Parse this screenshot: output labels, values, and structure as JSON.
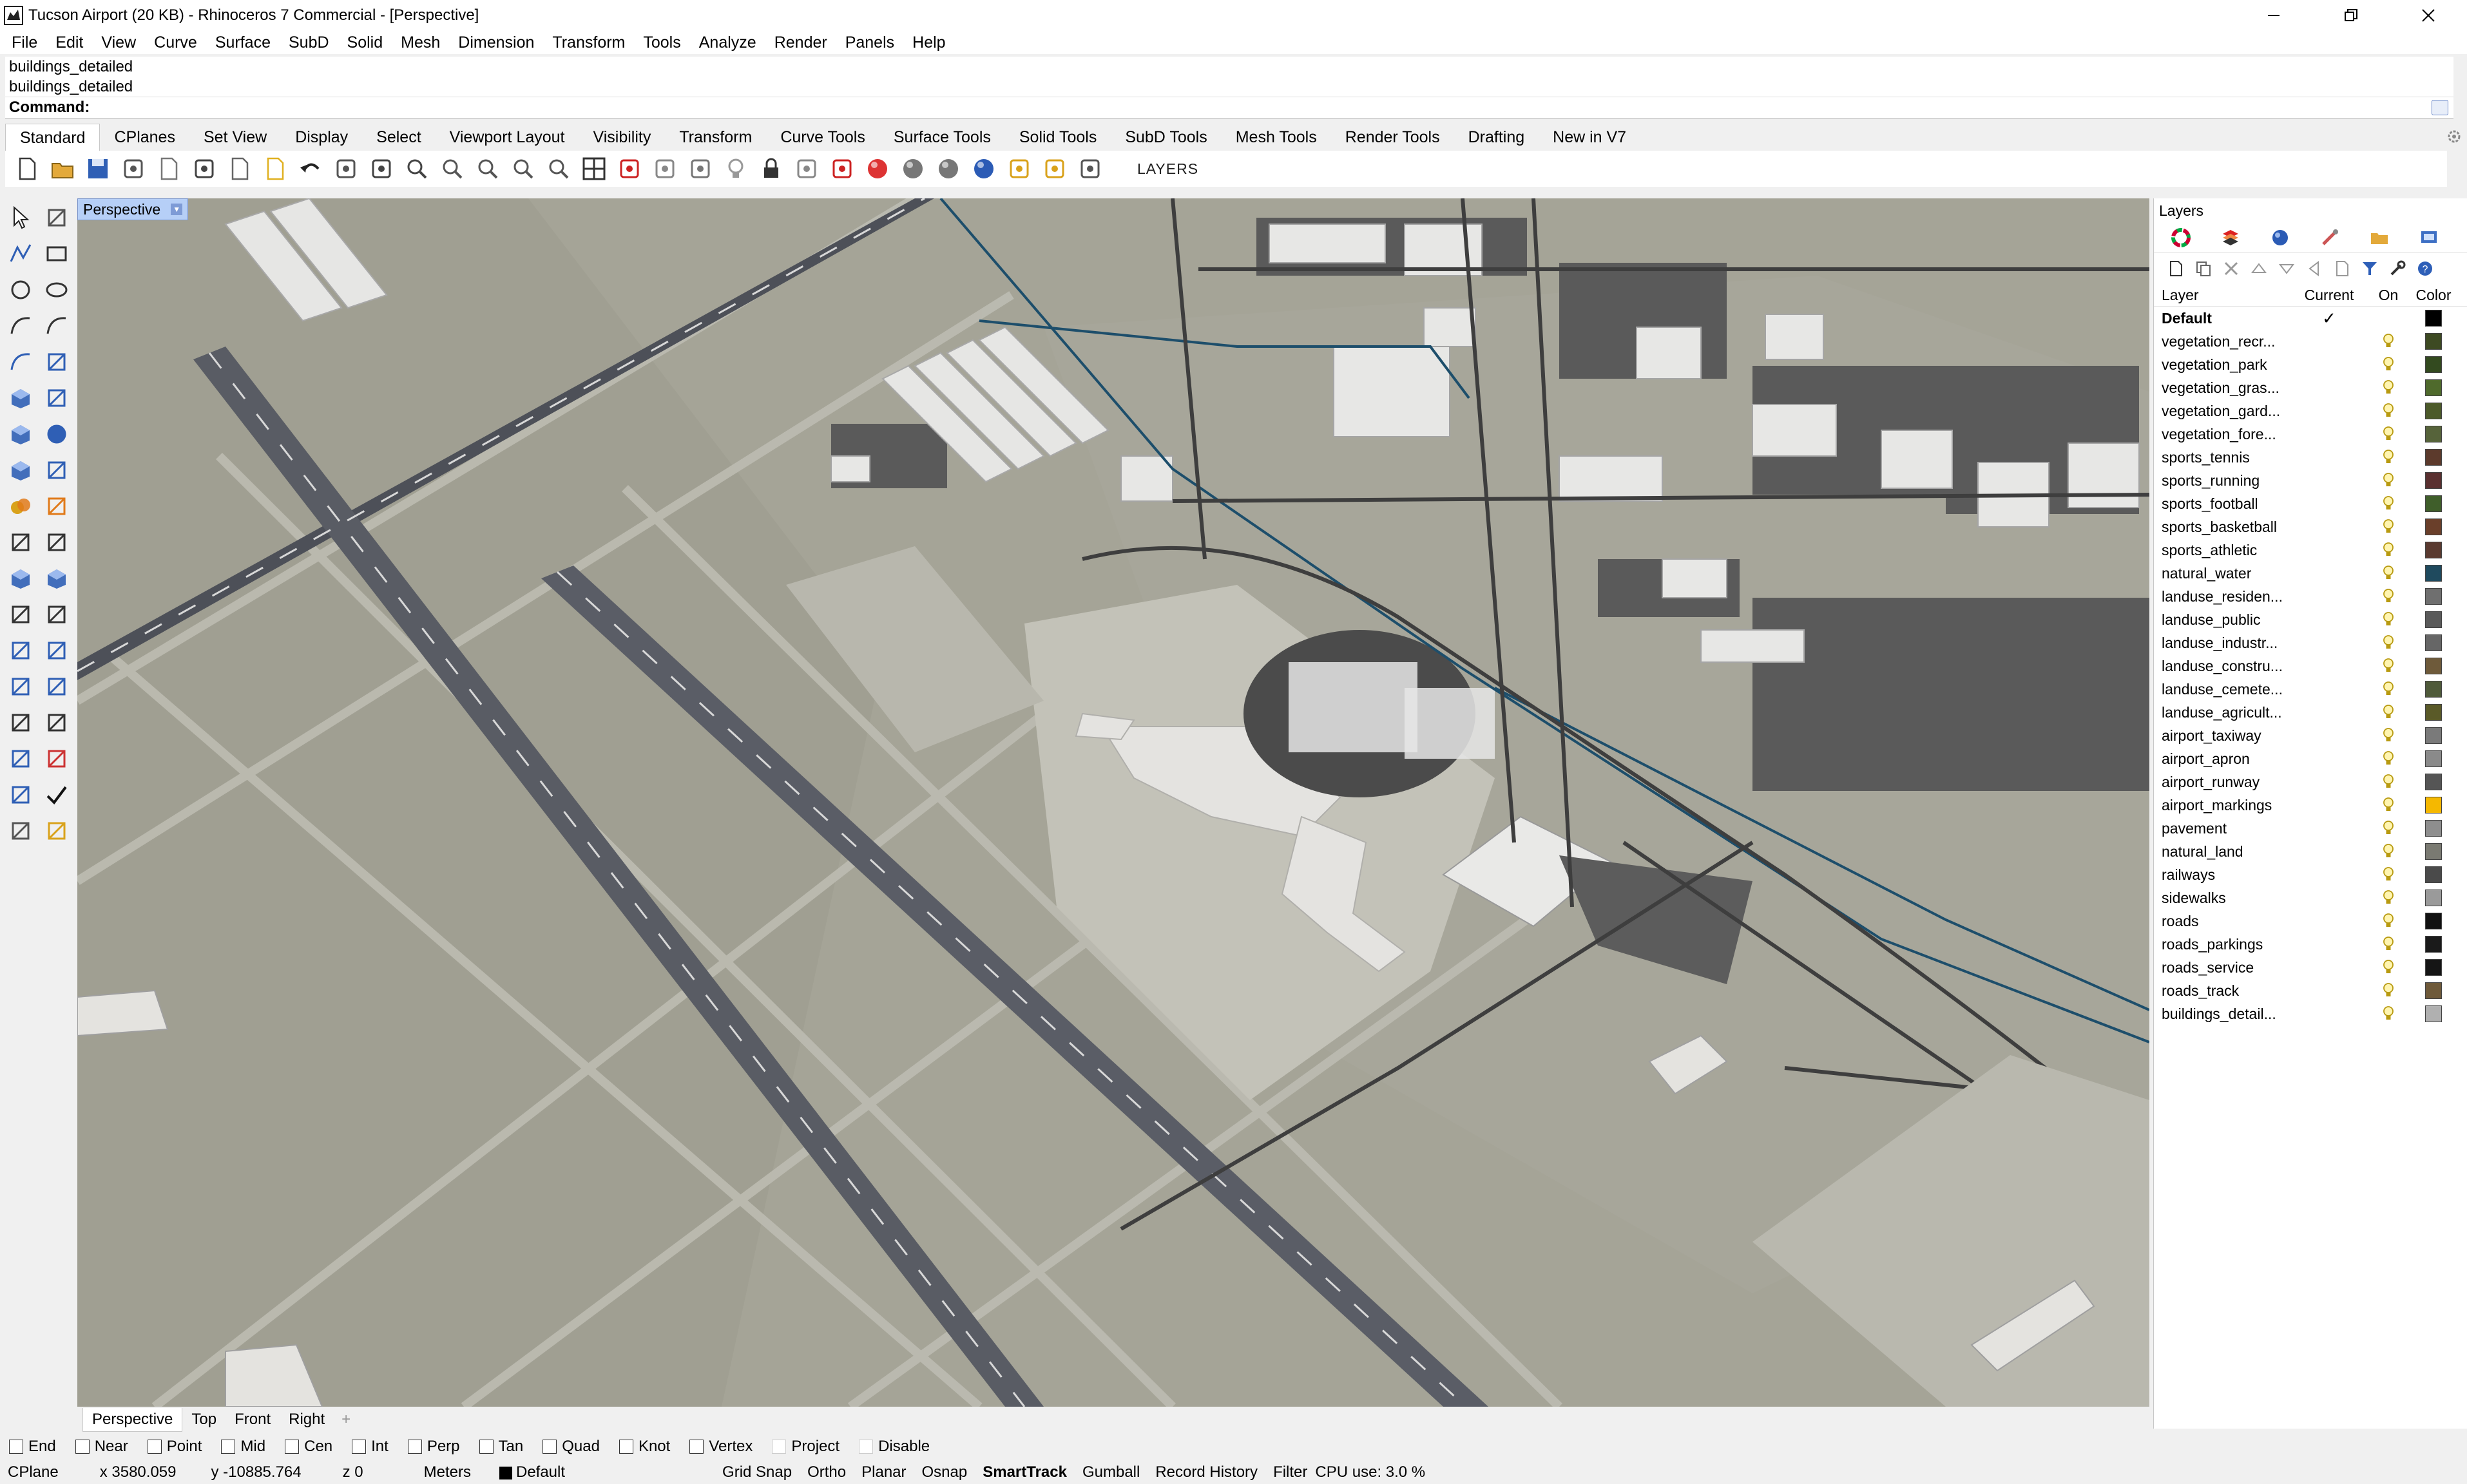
{
  "window": {
    "title": "Tucson Airport (20 KB) - Rhinoceros 7 Commercial - [Perspective]",
    "controls": [
      "minimize",
      "restore",
      "close"
    ]
  },
  "menu": [
    "File",
    "Edit",
    "View",
    "Curve",
    "Surface",
    "SubD",
    "Solid",
    "Mesh",
    "Dimension",
    "Transform",
    "Tools",
    "Analyze",
    "Render",
    "Panels",
    "Help"
  ],
  "command": {
    "history": [
      "buildings_detailed",
      "buildings_detailed"
    ],
    "prompt": "Command:",
    "value": ""
  },
  "toolbar_tabs": [
    "Standard",
    "CPlanes",
    "Set View",
    "Display",
    "Select",
    "Viewport Layout",
    "Visibility",
    "Transform",
    "Curve Tools",
    "Surface Tools",
    "Solid Tools",
    "SubD Tools",
    "Mesh Tools",
    "Render Tools",
    "Drafting",
    "New in V7"
  ],
  "toolbar_active_tab": "Standard",
  "toolbar_icons": [
    "new-file-icon",
    "open-icon",
    "save-icon",
    "print-icon",
    "import-icon",
    "cut-icon",
    "copy-icon",
    "paste-icon",
    "undo-icon",
    "pan-icon",
    "rotate-view-icon",
    "zoom-icon",
    "zoom-window-icon",
    "zoom-extents-icon",
    "zoom-selected-icon",
    "zoom-redo-icon",
    "four-viewports-icon",
    "car-icon",
    "shaded-icon",
    "properties-icon",
    "lightbulb-icon",
    "lock-icon",
    "select-filter-icon",
    "materials-icon",
    "color-wheel-icon",
    "rendered-sphere-icon",
    "ghosted-sphere-icon",
    "blue-sphere-icon",
    "dimension-icon",
    "gear-options-icon",
    "snap-grid-icon"
  ],
  "toolbar_layers_label": "LAYERS",
  "viewport": {
    "label": "Perspective",
    "tabs": [
      "Perspective",
      "Top",
      "Front",
      "Right"
    ],
    "active_tab": "Perspective",
    "add_tab": "+"
  },
  "layers_panel": {
    "title": "Layers",
    "columns": {
      "name": "Layer",
      "current": "Current",
      "on": "On",
      "color": "Color"
    },
    "layers": [
      {
        "name": "Default",
        "current": "✓",
        "color": "#000000"
      },
      {
        "name": "vegetation_recr...",
        "current": "",
        "color": "#3d4a22"
      },
      {
        "name": "vegetation_park",
        "current": "",
        "color": "#334a1f"
      },
      {
        "name": "vegetation_gras...",
        "current": "",
        "color": "#4f6a2c"
      },
      {
        "name": "vegetation_gard...",
        "current": "",
        "color": "#4c5a2a"
      },
      {
        "name": "vegetation_fore...",
        "current": "",
        "color": "#56633a"
      },
      {
        "name": "sports_tennis",
        "current": "",
        "color": "#5c3a2c"
      },
      {
        "name": "sports_running",
        "current": "",
        "color": "#5a3030"
      },
      {
        "name": "sports_football",
        "current": "",
        "color": "#3f5e2a"
      },
      {
        "name": "sports_basketball",
        "current": "",
        "color": "#6a3f2a"
      },
      {
        "name": "sports_athletic",
        "current": "",
        "color": "#5a3a30"
      },
      {
        "name": "natural_water",
        "current": "",
        "color": "#1f4a5e"
      },
      {
        "name": "landuse_residen...",
        "current": "",
        "color": "#6f6f6f"
      },
      {
        "name": "landuse_public",
        "current": "",
        "color": "#5a5a5a"
      },
      {
        "name": "landuse_industr...",
        "current": "",
        "color": "#666666"
      },
      {
        "name": "landuse_constru...",
        "current": "",
        "color": "#6e5a3a"
      },
      {
        "name": "landuse_cemete...",
        "current": "",
        "color": "#4f5a3a"
      },
      {
        "name": "landuse_agricult...",
        "current": "",
        "color": "#5a5a28"
      },
      {
        "name": "airport_taxiway",
        "current": "",
        "color": "#7a7a7a"
      },
      {
        "name": "airport_apron",
        "current": "",
        "color": "#8a8a8a"
      },
      {
        "name": "airport_runway",
        "current": "",
        "color": "#555555"
      },
      {
        "name": "airport_markings",
        "current": "",
        "color": "#f5b800"
      },
      {
        "name": "pavement",
        "current": "",
        "color": "#8e8e8e"
      },
      {
        "name": "natural_land",
        "current": "",
        "color": "#7a7a72"
      },
      {
        "name": "railways",
        "current": "",
        "color": "#4a4a4a"
      },
      {
        "name": "sidewalks",
        "current": "",
        "color": "#9a9a9a"
      },
      {
        "name": "roads",
        "current": "",
        "color": "#111111"
      },
      {
        "name": "roads_parkings",
        "current": "",
        "color": "#1a1a1a"
      },
      {
        "name": "roads_service",
        "current": "",
        "color": "#151515"
      },
      {
        "name": "roads_track",
        "current": "",
        "color": "#6f5a3a"
      },
      {
        "name": "buildings_detail...",
        "current": "",
        "color": "#b0b0b0"
      }
    ]
  },
  "osnaps": [
    {
      "label": "End"
    },
    {
      "label": "Near"
    },
    {
      "label": "Point"
    },
    {
      "label": "Mid"
    },
    {
      "label": "Cen"
    },
    {
      "label": "Int"
    },
    {
      "label": "Perp"
    },
    {
      "label": "Tan"
    },
    {
      "label": "Quad"
    },
    {
      "label": "Knot"
    },
    {
      "label": "Vertex"
    },
    {
      "label": "Project",
      "dim": true
    },
    {
      "label": "Disable",
      "dim": true
    }
  ],
  "status": {
    "cplane": "CPlane",
    "x": "x 3580.059",
    "y": "y -10885.764",
    "z": "z 0",
    "units": "Meters",
    "layer": "Default",
    "grid_snap": "Grid Snap",
    "ortho": "Ortho",
    "planar": "Planar",
    "osnap": "Osnap",
    "smarttrack": "SmartTrack",
    "gumball": "Gumball",
    "record_history": "Record History",
    "filter": "Filter",
    "cpu": "CPU use: 3.0 %"
  },
  "colors": {
    "accent": "#b6cff7",
    "ground": "#a9a89a",
    "runway": "#5a5c62",
    "building": "#e4e3e0",
    "parking": "#5a5a5a",
    "water": "#1d4e6b"
  }
}
